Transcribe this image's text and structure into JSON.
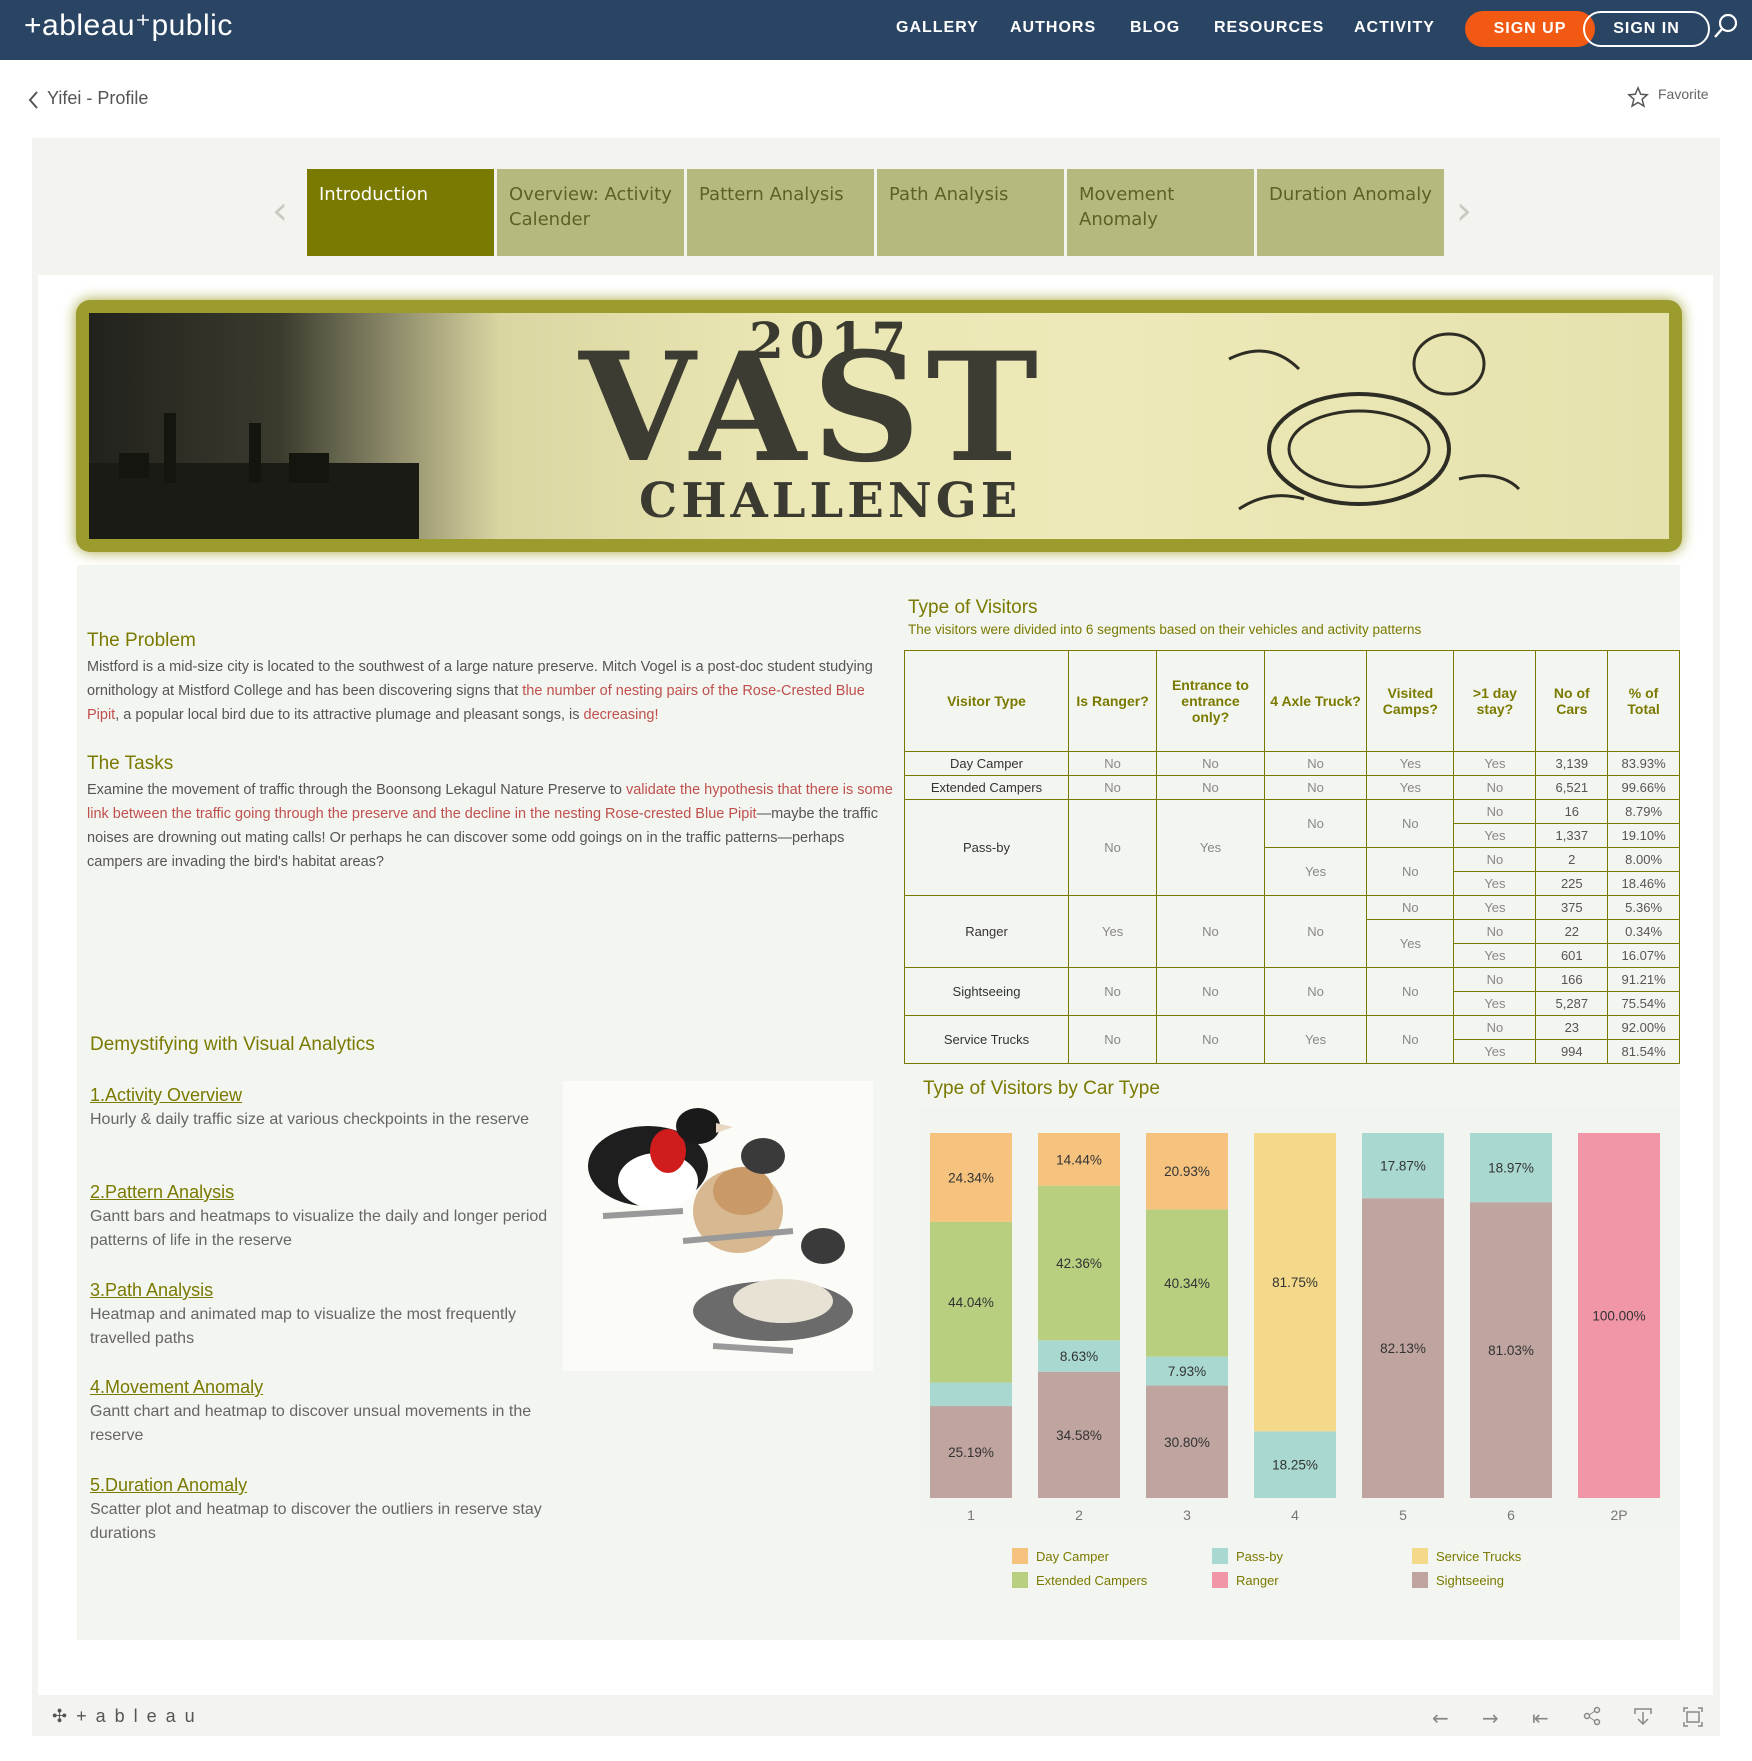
{
  "header": {
    "logo": "+ableau⁺public",
    "nav": [
      "GALLERY",
      "AUTHORS",
      "BLOG",
      "RESOURCES",
      "ACTIVITY"
    ],
    "signup": "SIGN UP",
    "signin": "SIGN IN"
  },
  "profile": {
    "back_label": "Yifei - Profile",
    "favorite_label": "Favorite"
  },
  "tabs": [
    {
      "label": "Introduction"
    },
    {
      "label": "Overview: Activity Calender"
    },
    {
      "label": "Pattern Analysis"
    },
    {
      "label": "Path Analysis"
    },
    {
      "label": "Movement Anomaly"
    },
    {
      "label": "Duration Anomaly"
    }
  ],
  "banner": {
    "year": "2017",
    "title": "VAST",
    "subtitle": "CHALLENGE"
  },
  "problem": {
    "heading": "The Problem",
    "text1": "Mistford is a mid-size city is located to the southwest of a large nature preserve.  Mitch Vogel is a post-doc student studying ornithology at Mistford College and has been discovering signs that ",
    "hl1": "the number of nesting pairs of the Rose-Crested Blue Pipit",
    "text2": ", a popular local bird due to its attractive plumage and pleasant songs, ",
    "text3": "is ",
    "hl2": "decreasing!"
  },
  "tasks": {
    "heading": "The Tasks",
    "text1": "Examine the movement of traffic through the Boonsong Lekagul Nature Preserve to ",
    "hl1": "validate the hypothesis that there is some link between the traffic going through the preserve and the decline in the nesting Rose-crested Blue Pipit",
    "text2": "—maybe the traffic noises are drowning out mating calls! Or perhaps he can discover some odd goings on in the traffic patterns—perhaps campers are invading the bird's habitat areas?"
  },
  "demystify": {
    "heading": "Demystifying with Visual Analytics",
    "items": [
      {
        "title": "1.Activity Overview",
        "desc": "Hourly & daily traffic size at various checkpoints in the reserve"
      },
      {
        "title": "2.Pattern Analysis",
        "desc": "Gantt bars and heatmaps to visualize the daily and longer period patterns of life in the reserve"
      },
      {
        "title": "3.Path Analysis",
        "desc": "Heatmap and  animated map to visualize the most frequently travelled paths"
      },
      {
        "title": "4.Movement Anomaly",
        "desc": "Gantt chart and heatmap to discover unsual movements in the reserve"
      },
      {
        "title": "5.Duration Anomaly",
        "desc": "Scatter plot and heatmap to discover the outliers in reserve stay durations"
      }
    ]
  },
  "visitor_table": {
    "title": "Type of Visitors",
    "subtitle": "The visitors were divided into 6 segments based on their vehicles and activity patterns",
    "headers": [
      "Visitor Type",
      "Is Ranger?",
      "Entrance to entrance only?",
      "4 Axle Truck?",
      "Visited Camps?",
      ">1 day stay?",
      "No of Cars",
      "% of Total"
    ],
    "rows": {
      "day_camper": {
        "type": "Day Camper",
        "ranger": "No",
        "e2e": "No",
        "axle": "No",
        "camps": "Yes",
        "stay": "Yes",
        "cars": "3,139",
        "pct": "83.93%"
      },
      "extended": {
        "type": "Extended Campers",
        "ranger": "No",
        "e2e": "No",
        "axle": "No",
        "camps": "Yes",
        "stay": "No",
        "cars": "6,521",
        "pct": "99.66%"
      },
      "passby": {
        "type": "Pass-by",
        "ranger": "No",
        "e2e": "Yes",
        "axle_a": "No",
        "camps_a": "No",
        "axle_b": "Yes",
        "camps_b": "No",
        "sub": [
          {
            "stay": "No",
            "cars": "16",
            "pct": "8.79%"
          },
          {
            "stay": "Yes",
            "cars": "1,337",
            "pct": "19.10%"
          },
          {
            "stay": "No",
            "cars": "2",
            "pct": "8.00%"
          },
          {
            "stay": "Yes",
            "cars": "225",
            "pct": "18.46%"
          }
        ]
      },
      "ranger": {
        "type": "Ranger",
        "ranger": "Yes",
        "e2e": "No",
        "axle": "No",
        "camps_a": "No",
        "camps_b": "Yes",
        "sub": [
          {
            "stay": "Yes",
            "cars": "375",
            "pct": "5.36%"
          },
          {
            "stay": "No",
            "cars": "22",
            "pct": "0.34%"
          },
          {
            "stay": "Yes",
            "cars": "601",
            "pct": "16.07%"
          }
        ]
      },
      "sightseeing": {
        "type": "Sightseeing",
        "ranger": "No",
        "e2e": "No",
        "axle": "No",
        "camps": "No",
        "sub": [
          {
            "stay": "No",
            "cars": "166",
            "pct": "91.21%"
          },
          {
            "stay": "Yes",
            "cars": "5,287",
            "pct": "75.54%"
          }
        ]
      },
      "service": {
        "type": "Service Trucks",
        "ranger": "No",
        "e2e": "No",
        "axle": "Yes",
        "camps": "No",
        "sub": [
          {
            "stay": "No",
            "cars": "23",
            "pct": "92.00%"
          },
          {
            "stay": "Yes",
            "cars": "994",
            "pct": "81.54%"
          }
        ]
      }
    }
  },
  "chart_data": {
    "type": "bar",
    "stacked": true,
    "title": "Type of Visitors by Car Type",
    "categories": [
      "1",
      "2",
      "3",
      "4",
      "5",
      "6",
      "2P"
    ],
    "ylim": [
      0,
      100
    ],
    "series": [
      {
        "name": "Sightseeing",
        "color": "#bfa49f",
        "values": [
          25.19,
          34.58,
          30.8,
          0,
          82.13,
          81.03,
          0
        ],
        "labels": [
          "25.19%",
          "34.58%",
          "30.80%",
          "",
          "82.13%",
          "81.03%",
          ""
        ]
      },
      {
        "name": "Pass-by",
        "color": "#a8d8cf",
        "values": [
          6.43,
          8.63,
          7.93,
          18.25,
          17.87,
          18.97,
          0
        ],
        "labels": [
          "",
          "8.63%",
          "7.93%",
          "18.25%",
          "17.87%",
          "18.97%",
          ""
        ]
      },
      {
        "name": "Extended Campers",
        "color": "#b8cf80",
        "values": [
          44.04,
          42.36,
          40.34,
          0,
          0,
          0,
          0
        ],
        "labels": [
          "44.04%",
          "42.36%",
          "40.34%",
          "",
          "",
          "",
          ""
        ]
      },
      {
        "name": "Day Camper",
        "color": "#f6c37f",
        "values": [
          24.34,
          14.44,
          20.93,
          0,
          0,
          0,
          0
        ],
        "labels": [
          "24.34%",
          "14.44%",
          "20.93%",
          "",
          "",
          "",
          ""
        ]
      },
      {
        "name": "Service Trucks",
        "color": "#f4d98a",
        "values": [
          0,
          0,
          0,
          81.75,
          0,
          0,
          0
        ],
        "labels": [
          "",
          "",
          "",
          "81.75%",
          "",
          "",
          ""
        ]
      },
      {
        "name": "Ranger",
        "color": "#f096a6",
        "values": [
          0,
          0,
          0,
          0,
          0,
          0,
          100
        ],
        "labels": [
          "",
          "",
          "",
          "",
          "",
          "",
          "100.00%"
        ]
      }
    ],
    "legend": [
      {
        "name": "Day Camper",
        "color": "#f6c37f"
      },
      {
        "name": "Pass-by",
        "color": "#a8d8cf"
      },
      {
        "name": "Service Trucks",
        "color": "#f4d98a"
      },
      {
        "name": "Extended Campers",
        "color": "#b8cf80"
      },
      {
        "name": "Ranger",
        "color": "#f096a6"
      },
      {
        "name": "Sightseeing",
        "color": "#bfa49f"
      }
    ]
  },
  "footer": {
    "brand": "+ a b l e a u"
  },
  "colors": {
    "navy": "#2a4564",
    "orange": "#f25a13",
    "olive": "#7a7a00",
    "highlight": "#c0504d"
  }
}
